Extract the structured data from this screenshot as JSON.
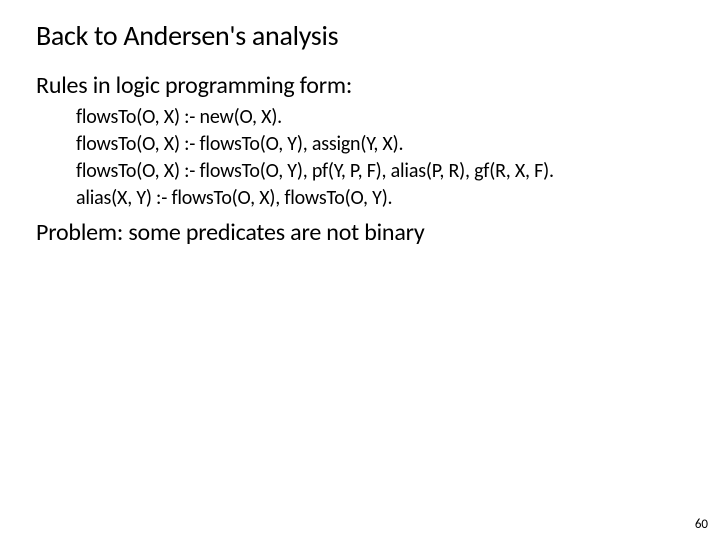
{
  "title": "Back to Andersen's analysis",
  "subtitle": "Rules in logic programming form:",
  "rules": {
    "r0": "flowsTo(O, X) :- new(O, X).",
    "r1": "flowsTo(O, X) :- flowsTo(O, Y), assign(Y, X).",
    "r2": "flowsTo(O, X) :- flowsTo(O, Y), pf(Y, P, F), alias(P, R), gf(R, X, F).",
    "r3": "alias(X, Y)   :- flowsTo(O, X), flowsTo(O, Y)."
  },
  "problem": "Problem: some predicates are not binary",
  "page_number": "60"
}
